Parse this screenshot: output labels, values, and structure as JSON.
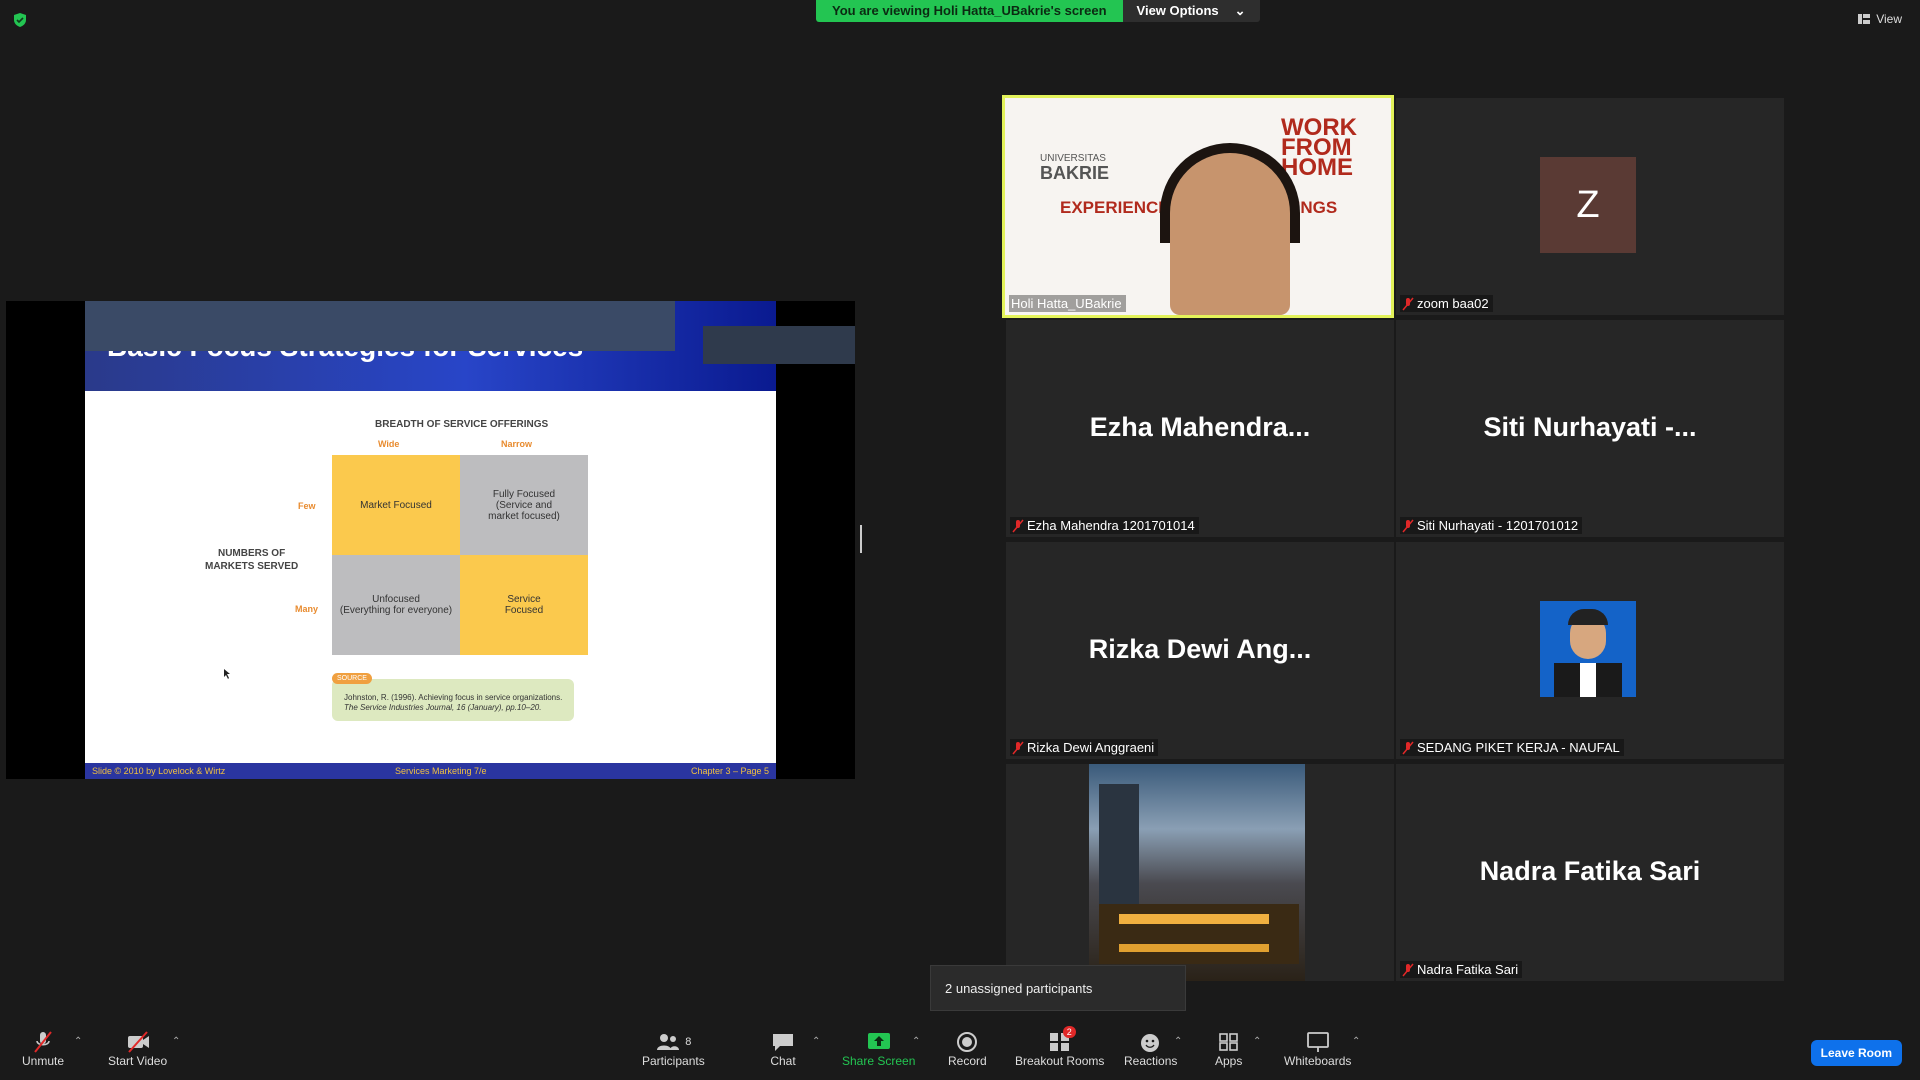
{
  "top_bar": {
    "viewing_banner": "You are viewing Holi Hatta_UBakrie's screen",
    "view_options": "View Options",
    "view_label": "View"
  },
  "slide": {
    "title": "Basic Focus Strategies for Services",
    "breadth_heading": "BREADTH OF SERVICE OFFERINGS",
    "wide": "Wide",
    "narrow": "Narrow",
    "few": "Few",
    "many": "Many",
    "markets_line1": "NUMBERS OF",
    "markets_line2": "MARKETS SERVED",
    "cell_market_focused": "Market Focused",
    "cell_fully_focused_1": "Fully Focused",
    "cell_fully_focused_2": "(Service and",
    "cell_fully_focused_3": "market focused)",
    "cell_unfocused_1": "Unfocused",
    "cell_unfocused_2": "(Everything for everyone)",
    "cell_service_focused_1": "Service",
    "cell_service_focused_2": "Focused",
    "source_tag": "SOURCE",
    "source_line1": "Johnston, R. (1996). Achieving focus in service organizations.",
    "source_line2": "The Service Industries Journal, 16 (January), pp.10–20.",
    "footer_left": "Slide © 2010 by Lovelock & Wirtz",
    "footer_mid": "Services Marketing 7/e",
    "footer_right": "Chapter 3 – Page 5"
  },
  "gallery": {
    "holi": {
      "label": "Holi Hatta_UBakrie",
      "bg_brand_1": "UNIVERSITAS",
      "bg_brand_2": "BAKRIE",
      "bg_work": "WORK",
      "bg_from": "FROM",
      "bg_home": "HOME",
      "bg_experience": "EXPERIENCE",
      "bg_things": "THINGS"
    },
    "zoom": {
      "avatar_letter": "Z",
      "label": "zoom baa02"
    },
    "ezha": {
      "big": "Ezha  Mahendra...",
      "label": "Ezha Mahendra 1201701014"
    },
    "siti": {
      "big": "Siti Nurhayati -...",
      "label": "Siti Nurhayati - 1201701012"
    },
    "rizka": {
      "big": "Rizka Dewi Ang...",
      "label": "Rizka Dewi Anggraeni"
    },
    "naufal": {
      "label": "SEDANG PIKET KERJA - NAUFAL"
    },
    "nadra": {
      "big": "Nadra Fatika Sari",
      "label": "Nadra Fatika Sari"
    }
  },
  "popover": {
    "text": "2 unassigned participants"
  },
  "toolbar": {
    "unmute": "Unmute",
    "start_video": "Start Video",
    "participants": "Participants",
    "participants_count": "8",
    "chat": "Chat",
    "share_screen": "Share Screen",
    "record": "Record",
    "breakout_rooms": "Breakout Rooms",
    "breakout_badge": "2",
    "reactions": "Reactions",
    "apps": "Apps",
    "whiteboards": "Whiteboards",
    "leave": "Leave Room"
  },
  "colors": {
    "accent_green": "#23c552",
    "active_speaker_border": "#e3f25a",
    "leave_blue": "#0e71eb",
    "muted_red": "#e02828"
  },
  "icons": [
    "shield-icon",
    "chevron-down-icon",
    "view-grid-icon",
    "mic-off-icon",
    "video-off-icon",
    "participants-icon",
    "chat-icon",
    "share-screen-icon",
    "record-icon",
    "breakout-rooms-icon",
    "reactions-icon",
    "apps-icon",
    "whiteboard-icon",
    "caret-up-icon"
  ]
}
